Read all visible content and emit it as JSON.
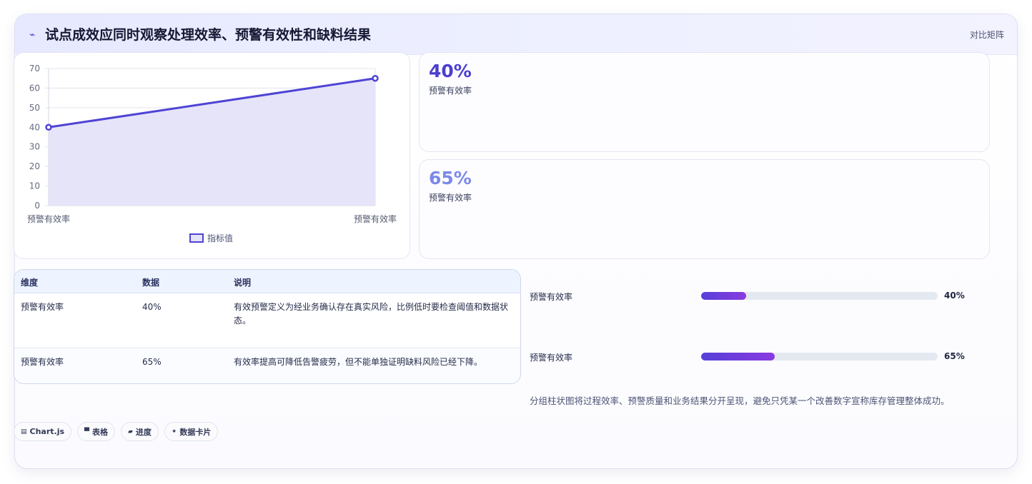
{
  "header": {
    "icon": "lightning-icon",
    "title": "试点成效应同时观察处理效率、预警有效性和缺料结果",
    "link": "对比矩阵"
  },
  "chart_data": {
    "type": "line",
    "fill": "area",
    "categories": [
      "预警有效率",
      "预警有效率"
    ],
    "series": [
      {
        "name": "指标值",
        "values": [
          40,
          65
        ]
      }
    ],
    "ylim": [
      0,
      70
    ],
    "yticks": [
      0,
      10,
      20,
      30,
      40,
      50,
      60,
      70
    ],
    "grid": true,
    "legend_position": "bottom",
    "colors": {
      "line": "#4e44d4",
      "fill": "#e5e3f8"
    }
  },
  "stats": [
    {
      "value": "40%",
      "label": "预警有效率"
    },
    {
      "value": "65%",
      "label": "预警有效率"
    }
  ],
  "table": {
    "headers": [
      "维度",
      "数据",
      "说明"
    ],
    "rows": [
      [
        "预警有效率",
        "40%",
        "有效预警定义为经业务确认存在真实风险，比例低时要检查阈值和数据状态。"
      ],
      [
        "预警有效率",
        "65%",
        "有效率提高可降低告警疲劳，但不能单独证明缺料风险已经下降。"
      ]
    ]
  },
  "progress": [
    {
      "label": "预警有效率",
      "value": "40%",
      "fill": 0.19
    },
    {
      "label": "预警有效率",
      "value": "65%",
      "fill": 0.31
    }
  ],
  "note": "分组柱状图将过程效率、预警质量和业务结果分开呈现，避免只凭某一个改善数字宣称库存管理整体成功。",
  "tags": [
    {
      "icon": "chart-icon",
      "label": "Chart.js"
    },
    {
      "icon": "table-icon",
      "label": "表格"
    },
    {
      "icon": "progress-icon",
      "label": "进度"
    },
    {
      "icon": "card-icon",
      "label": "数据卡片"
    }
  ]
}
